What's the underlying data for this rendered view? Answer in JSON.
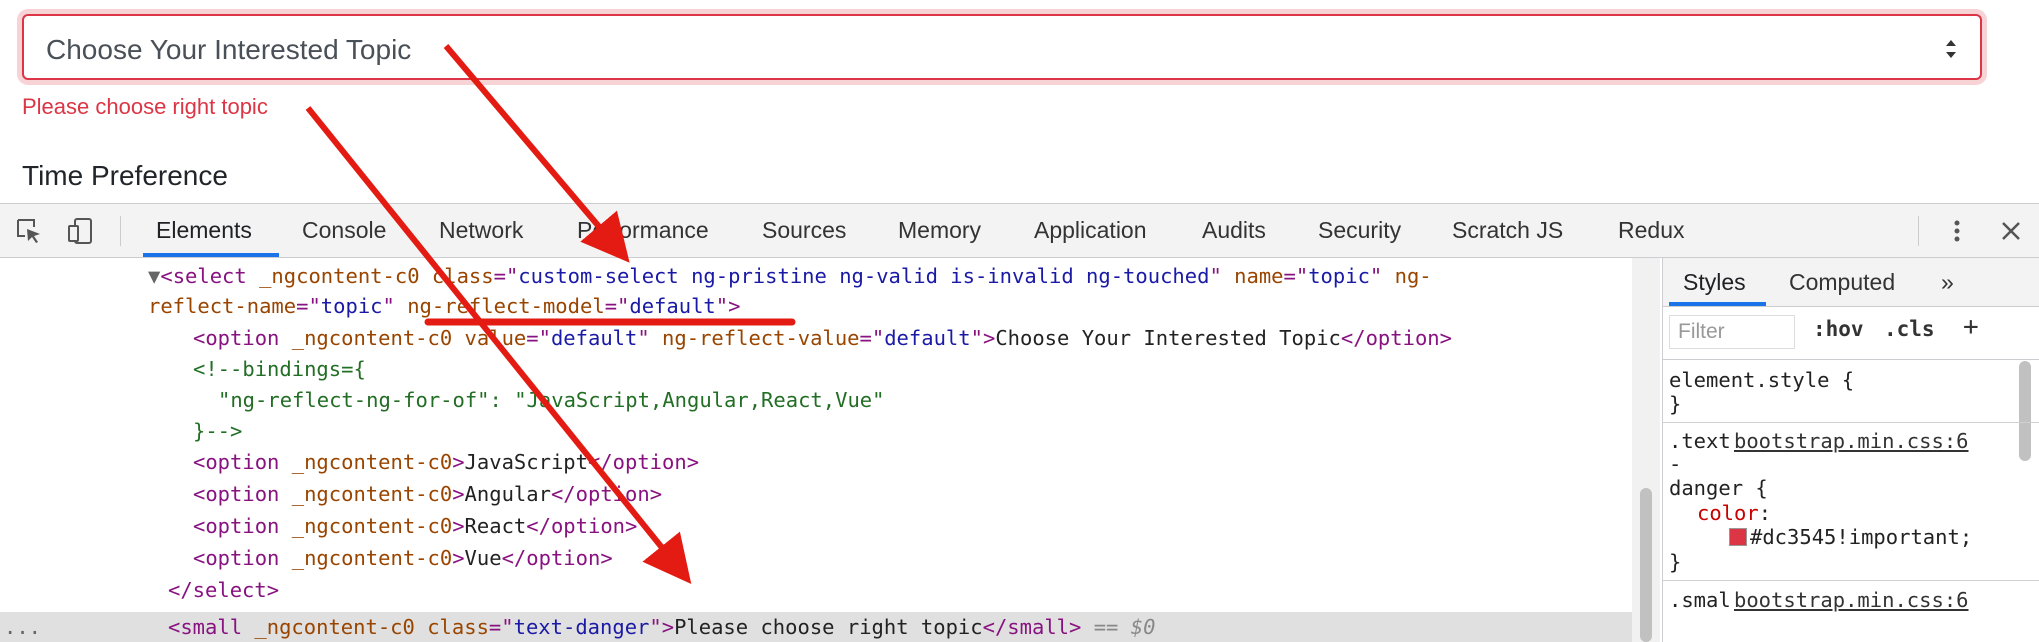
{
  "page": {
    "select_text": "Choose Your Interested Topic",
    "error_text": "Please choose right topic",
    "next_label": "Time Preference"
  },
  "devtools": {
    "tabs": [
      "Elements",
      "Console",
      "Network",
      "Performance",
      "Sources",
      "Memory",
      "Application",
      "Audits",
      "Security",
      "Scratch JS",
      "Redux"
    ],
    "active_tab": "Elements",
    "icons": {
      "inspect": "inspect-cursor-icon",
      "device": "device-toolbar-icon",
      "more": "kebab-menu-icon",
      "close": "close-icon"
    },
    "dom": {
      "select_open": {
        "tag": "select",
        "ngattr": "_ngcontent-c0",
        "class_name": "class",
        "class_val": "custom-select ng-pristine ng-valid is-invalid ng-touched",
        "name_name": "name",
        "name_val": "topic",
        "ng_prefix": "ng-",
        "rn_suffix": "reflect-name",
        "rn_val": "topic",
        "rm_name": "ng-reflect-model",
        "rm_val": "default"
      },
      "opt_default": {
        "value_name": "value",
        "value_val": "default",
        "rv_name": "ng-reflect-value",
        "rv_val": "default",
        "text": "Choose Your Interested Topic"
      },
      "comment_open": "<!--bindings={",
      "comment_body": "\"ng-reflect-ng-for-of\": \"JavaScript,Angular,React,Vue\"",
      "comment_close": "}-->",
      "options": [
        "JavaScript",
        "Angular",
        "React",
        "Vue"
      ],
      "select_close": "</select>",
      "small": {
        "class_val": "text-danger",
        "text": "Please choose right topic",
        "suffix": " == ",
        "dollar": "$0"
      }
    },
    "styles": {
      "tabs": [
        "Styles",
        "Computed"
      ],
      "more": "»",
      "filter_placeholder": "Filter",
      "hov": ":hov",
      "cls": ".cls",
      "plus": "+",
      "element_style": "element.style {",
      "close_brace": "}",
      "rule1_selector": ".text",
      "rule1_source": "bootstrap.min.css:6",
      "rule1_dash": "-",
      "rule1_selector2": "danger {",
      "prop": "color",
      "prop_value": "#dc3545!important;",
      "rule2_selector": ".smal",
      "rule2_source": "bootstrap.min.css:6"
    },
    "colors": {
      "danger": "#dc3545",
      "accent": "#1a73e8",
      "arrow": "#e31b12"
    }
  }
}
